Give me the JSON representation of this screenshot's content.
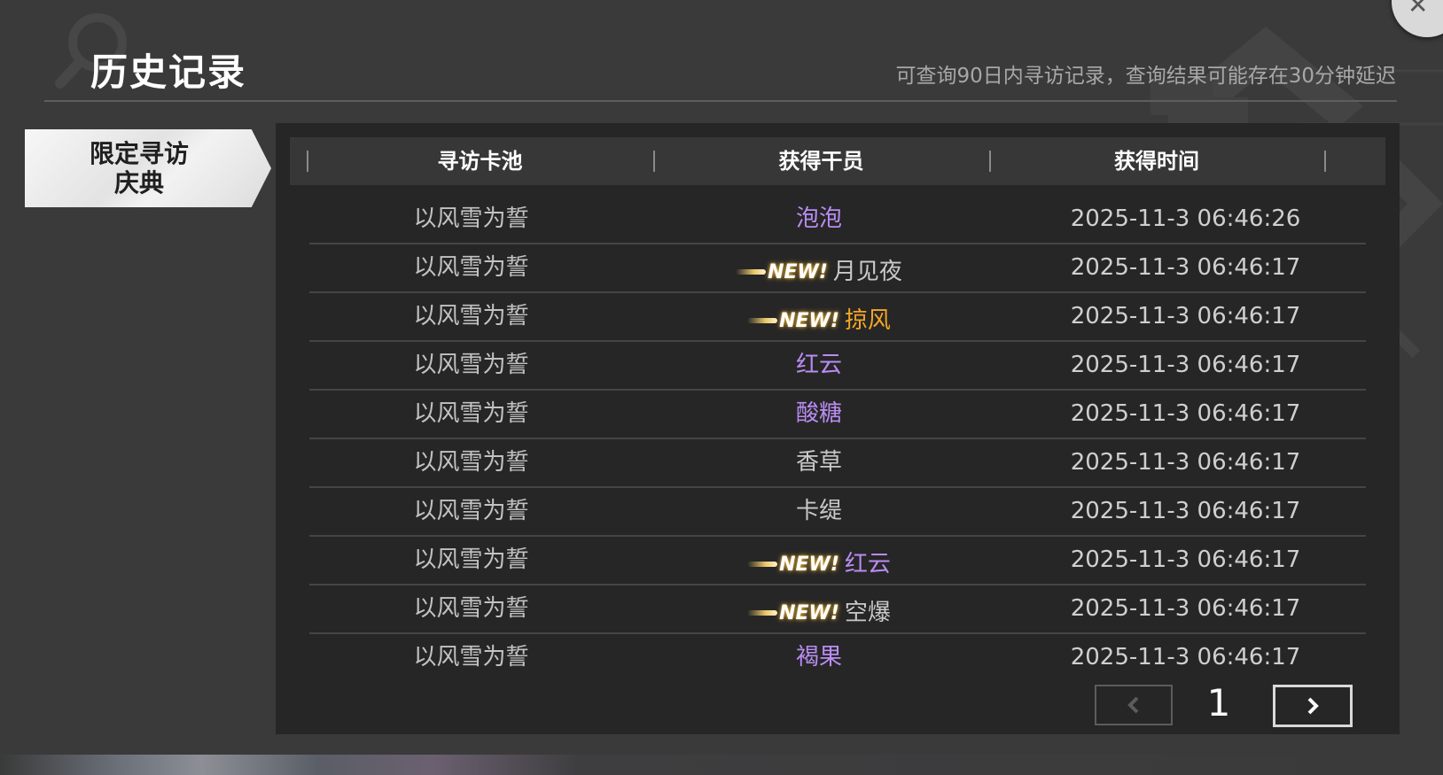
{
  "header": {
    "title": "历史记录",
    "notice": "可查询90日内寻访记录，查询结果可能存在30分钟延迟"
  },
  "sidebar": {
    "tab": {
      "line1": "限定寻访",
      "line2": "庆典"
    }
  },
  "table": {
    "columns": [
      "寻访卡池",
      "获得干员",
      "获得时间"
    ],
    "new_label": "NEW!",
    "rows": [
      {
        "pool": "以风雪为誓",
        "operator": "泡泡",
        "time": "2025-11-3 06:46:26",
        "is_new": false,
        "color": "#b98cf2"
      },
      {
        "pool": "以风雪为誓",
        "operator": "月见夜",
        "time": "2025-11-3 06:46:17",
        "is_new": true,
        "color": "#c9c9c9"
      },
      {
        "pool": "以风雪为誓",
        "operator": "掠风",
        "time": "2025-11-3 06:46:17",
        "is_new": true,
        "color": "#f5a623"
      },
      {
        "pool": "以风雪为誓",
        "operator": "红云",
        "time": "2025-11-3 06:46:17",
        "is_new": false,
        "color": "#b98cf2"
      },
      {
        "pool": "以风雪为誓",
        "operator": "酸糖",
        "time": "2025-11-3 06:46:17",
        "is_new": false,
        "color": "#b98cf2"
      },
      {
        "pool": "以风雪为誓",
        "operator": "香草",
        "time": "2025-11-3 06:46:17",
        "is_new": false,
        "color": "#c9c9c9"
      },
      {
        "pool": "以风雪为誓",
        "operator": "卡缇",
        "time": "2025-11-3 06:46:17",
        "is_new": false,
        "color": "#c9c9c9"
      },
      {
        "pool": "以风雪为誓",
        "operator": "红云",
        "time": "2025-11-3 06:46:17",
        "is_new": true,
        "color": "#b98cf2"
      },
      {
        "pool": "以风雪为誓",
        "operator": "空爆",
        "time": "2025-11-3 06:46:17",
        "is_new": true,
        "color": "#c9c9c9"
      },
      {
        "pool": "以风雪为誓",
        "operator": "褐果",
        "time": "2025-11-3 06:46:17",
        "is_new": false,
        "color": "#b98cf2"
      }
    ]
  },
  "pagination": {
    "current_page": "1"
  },
  "icons": {
    "close": "close-icon",
    "prev": "chevron-left-icon",
    "next": "chevron-right-icon",
    "bg_search": "search-icon"
  }
}
